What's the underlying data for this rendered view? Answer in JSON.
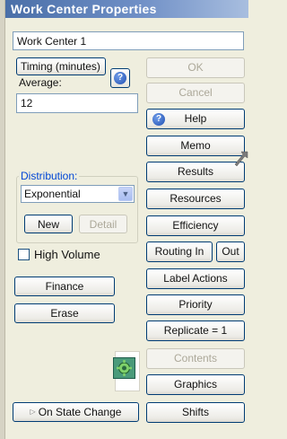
{
  "window": {
    "title": "Work Center Properties"
  },
  "name_field": {
    "value": "Work Center 1"
  },
  "timing": {
    "label": "Timing (minutes)",
    "average_label": "Average:",
    "average_value": "12",
    "help_glyph": "?"
  },
  "distribution": {
    "label": "Distribution:",
    "selected": "Exponential",
    "new_label": "New",
    "detail_label": "Detail"
  },
  "high_volume": {
    "label": "High Volume",
    "checked": false
  },
  "left_buttons": {
    "finance": "Finance",
    "erase": "Erase",
    "on_state_change": "On State Change"
  },
  "right_buttons": {
    "ok": "OK",
    "cancel": "Cancel",
    "help": "Help",
    "memo": "Memo",
    "results": "Results",
    "resources": "Resources",
    "efficiency": "Efficiency",
    "routing_in": "Routing In",
    "out": "Out",
    "label_actions": "Label Actions",
    "priority": "Priority",
    "replicate": "Replicate = 1",
    "contents": "Contents",
    "graphics": "Graphics",
    "shifts": "Shifts"
  },
  "icons": {
    "help": "help-icon",
    "gear": "gear-icon",
    "cursor": "mouse-pointer-icon",
    "state": "state-change-icon"
  },
  "colors": {
    "title_bar": "#4a6fa8",
    "window_bg": "#efeede",
    "group_label": "#0046d5"
  }
}
